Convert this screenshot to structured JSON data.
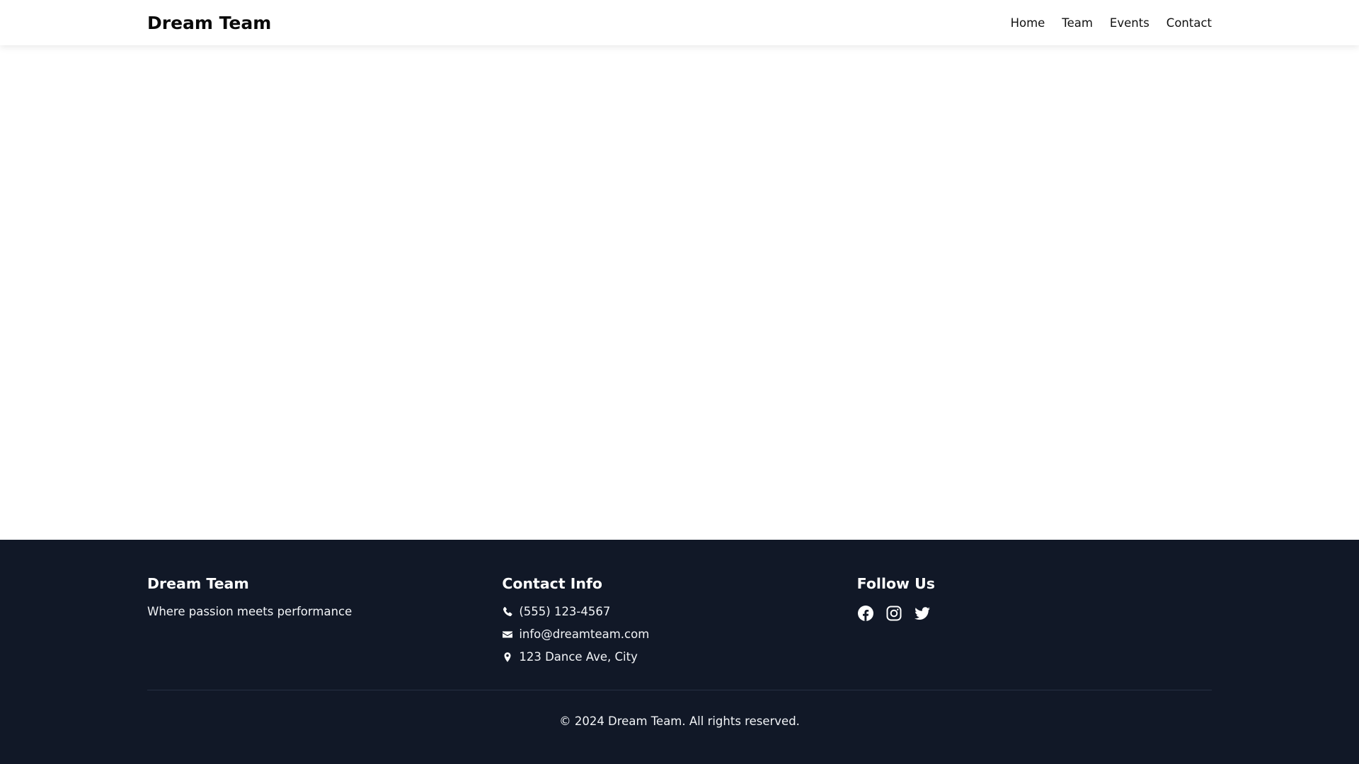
{
  "header": {
    "brand": "Dream Team",
    "nav": [
      {
        "label": "Home"
      },
      {
        "label": "Team"
      },
      {
        "label": "Events"
      },
      {
        "label": "Contact"
      }
    ]
  },
  "footer": {
    "about": {
      "title": "Dream Team",
      "tagline": "Where passion meets performance"
    },
    "contact": {
      "title": "Contact Info",
      "phone": "(555) 123-4567",
      "email": "info@dreamteam.com",
      "address": "123 Dance Ave, City"
    },
    "social": {
      "title": "Follow Us",
      "icons": [
        "facebook-icon",
        "instagram-icon",
        "twitter-icon"
      ]
    },
    "copyright": "© 2024 Dream Team. All rights reserved."
  },
  "colors": {
    "header_bg": "#ffffff",
    "footer_bg": "#111827",
    "text_dark": "#111111",
    "text_light": "#ffffff"
  }
}
